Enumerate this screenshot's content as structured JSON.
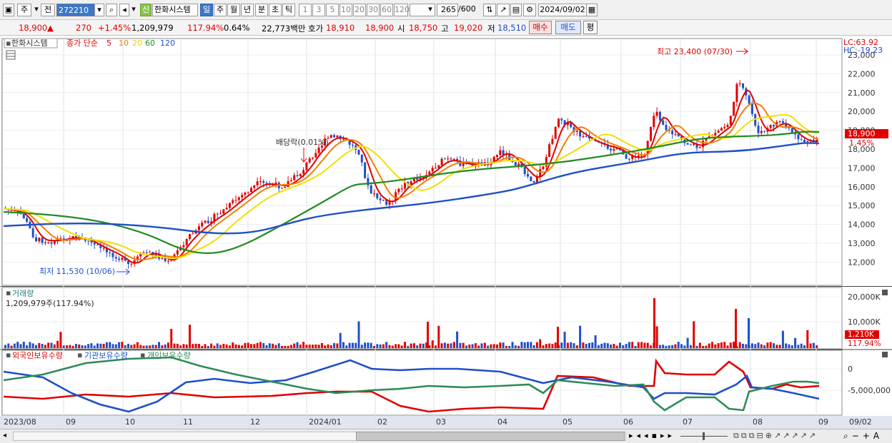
{
  "toolbar": {
    "tab_stock": "주",
    "tab_prev": "전",
    "code": "272210",
    "new_badge": "신",
    "stock_name": "한화시스템",
    "periods": [
      "일",
      "주",
      "월",
      "년",
      "분",
      "초",
      "틱"
    ],
    "active_period": "일",
    "intervals": [
      "1",
      "3",
      "5",
      "10",
      "20",
      "30",
      "60",
      "120"
    ],
    "count": "265",
    "count_max": "/600",
    "date": "2024/09/02"
  },
  "quote": {
    "price": "18,900",
    "arrow": "▲",
    "change": "270",
    "change_pct": "+1.45%",
    "volume": "1,209,979",
    "volume_ratio": "117.94%",
    "turnover_pct": "0.64%",
    "amount": "22,773백만",
    "hoga_label": "호가",
    "ask": "18,910",
    "bid": "18,900",
    "open_label": "시",
    "open": "18,750",
    "high_label": "고",
    "high": "19,020",
    "low_label": "저",
    "low": "18,510",
    "buy_button": "매수",
    "sell_button": "매도",
    "eval_button": "평"
  },
  "price_panel": {
    "title": "한화시스템",
    "ma_label": "종가 단순",
    "ma_periods": [
      {
        "label": "5",
        "color": "#e00000"
      },
      {
        "label": "10",
        "color": "#f08000"
      },
      {
        "label": "20",
        "color": "#f0e000"
      },
      {
        "label": "60",
        "color": "#228b22"
      },
      {
        "label": "120",
        "color": "#1e50c8"
      }
    ],
    "lc": "LC:63.92",
    "hc": "HC:-19.23",
    "high_annotation": "최고 23,400 (07/30)",
    "low_annotation": "최저 11,530 (10/06)",
    "dividend_annotation": "배당락(0.01%)",
    "current_price_tag": "18,900",
    "current_pct_tag": "1.45%",
    "y_ticks": [
      "23,000",
      "22,000",
      "21,000",
      "20,000",
      "19,000",
      "18,000",
      "17,000",
      "16,000",
      "15,000",
      "14,000",
      "13,000",
      "12,000"
    ]
  },
  "volume_panel": {
    "title": "거래량",
    "value": "1,209,979주(117.94%)",
    "y_ticks": [
      "20,000K",
      "10,000K"
    ],
    "tag_value": "1,210K",
    "tag_pct": "117.94%"
  },
  "holdings_panel": {
    "legend": [
      {
        "label": "외국인보유수량",
        "color": "#e00000"
      },
      {
        "label": "기관보유수량",
        "color": "#1e50c8"
      },
      {
        "label": "개인보유수량",
        "color": "#2e8b57"
      }
    ],
    "y_ticks": [
      "0",
      "-5,000,000"
    ]
  },
  "x_axis": [
    "2023/08",
    "09",
    "10",
    "11",
    "12",
    "2024/01",
    "02",
    "03",
    "04",
    "05",
    "06",
    "07",
    "08",
    "09",
    "09/02"
  ],
  "colors": {
    "up": "#e00000",
    "down": "#1e50c8",
    "accent": "#3c78c8"
  }
}
